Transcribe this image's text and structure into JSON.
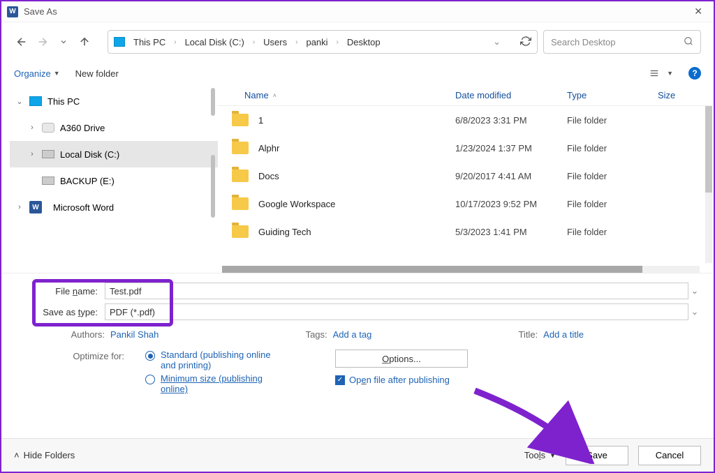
{
  "window": {
    "title": "Save As"
  },
  "breadcrumbs": [
    "This PC",
    "Local Disk (C:)",
    "Users",
    "panki",
    "Desktop"
  ],
  "search": {
    "placeholder": "Search Desktop"
  },
  "toolbar": {
    "organize": "Organize",
    "newfolder": "New folder"
  },
  "tree": {
    "thispc": "This PC",
    "a360": "A360 Drive",
    "localdisk": "Local Disk (C:)",
    "backup": "BACKUP (E:)",
    "word": "Microsoft Word"
  },
  "columns": {
    "name": "Name",
    "date": "Date modified",
    "type": "Type",
    "size": "Size"
  },
  "files": [
    {
      "name": "1",
      "date": "6/8/2023 3:31 PM",
      "type": "File folder"
    },
    {
      "name": "Alphr",
      "date": "1/23/2024 1:37 PM",
      "type": "File folder"
    },
    {
      "name": "Docs",
      "date": "9/20/2017 4:41 AM",
      "type": "File folder"
    },
    {
      "name": "Google Workspace",
      "date": "10/17/2023 9:52 PM",
      "type": "File folder"
    },
    {
      "name": "Guiding Tech",
      "date": "5/3/2023 1:41 PM",
      "type": "File folder"
    }
  ],
  "form": {
    "filename_label": "File name:",
    "filename_value": "Test.pdf",
    "savetype_label": "Save as type:",
    "savetype_value": "PDF (*.pdf)"
  },
  "meta": {
    "authors_label": "Authors:",
    "authors_value": "Pankil Shah",
    "tags_label": "Tags:",
    "tags_value": "Add a tag",
    "title_label": "Title:",
    "title_value": "Add a title"
  },
  "optimize": {
    "label": "Optimize for:",
    "standard": "Standard (publishing online and printing)",
    "minimum": "Minimum size (publishing online)"
  },
  "options": {
    "button": "Options...",
    "openafter": "Open file after publishing"
  },
  "bottom": {
    "hide": "Hide Folders",
    "tools": "Tools",
    "save": "Save",
    "cancel": "Cancel"
  }
}
